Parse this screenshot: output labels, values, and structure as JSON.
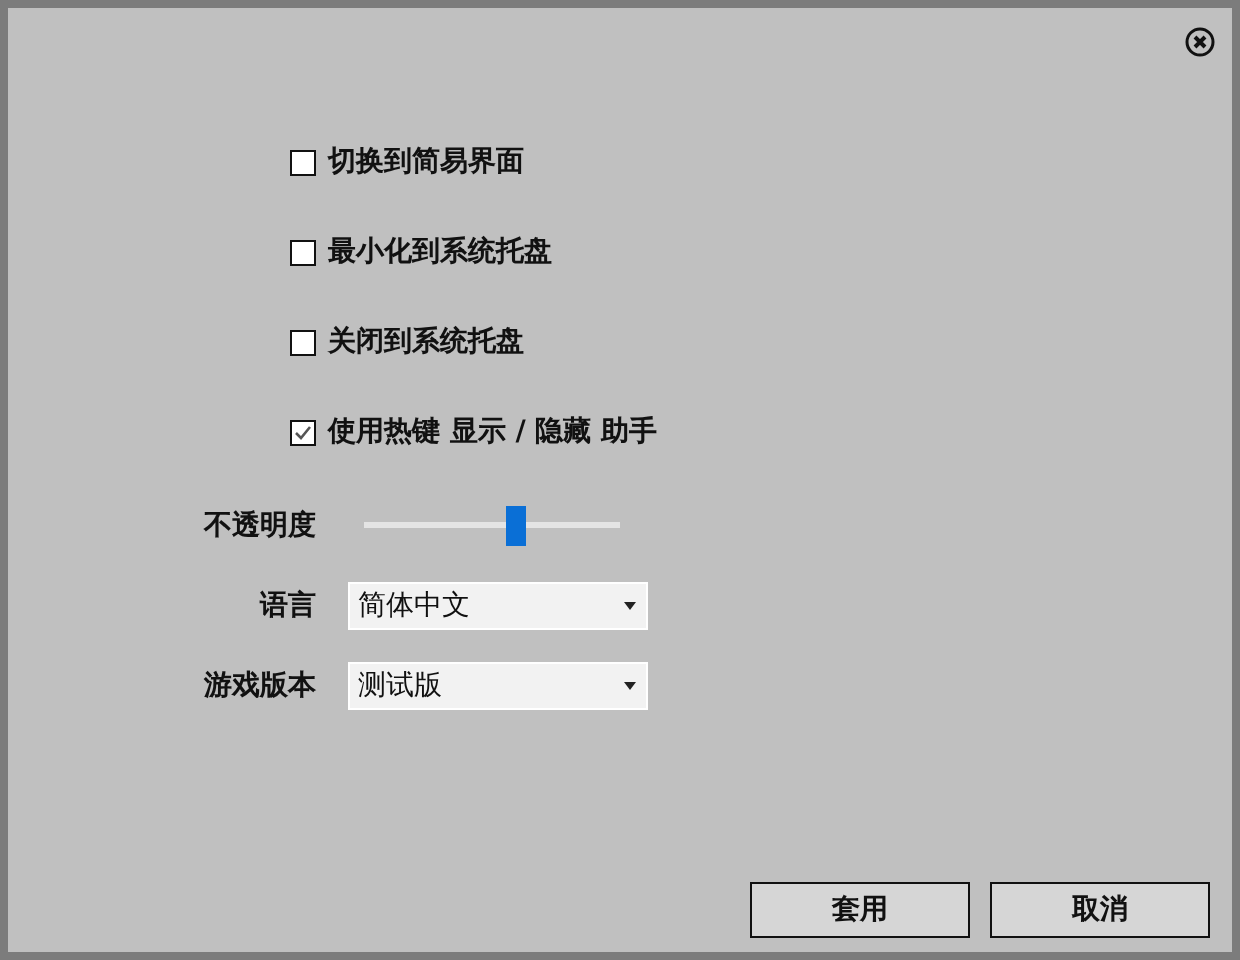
{
  "options": [
    {
      "label": "切换到简易界面",
      "checked": false
    },
    {
      "label": "最小化到系统托盘",
      "checked": false
    },
    {
      "label": "关闭到系统托盘",
      "checked": false
    },
    {
      "label": "使用热键 显示 / 隐藏 助手",
      "checked": true
    }
  ],
  "settings": [
    {
      "kind": "slider",
      "label": "不透明度",
      "level": 0.59
    },
    {
      "kind": "select",
      "label": "语言",
      "value": "简体中文"
    },
    {
      "kind": "select",
      "label": "游戏版本",
      "value": "测试版"
    }
  ],
  "buttons": [
    "套用",
    "取消"
  ]
}
